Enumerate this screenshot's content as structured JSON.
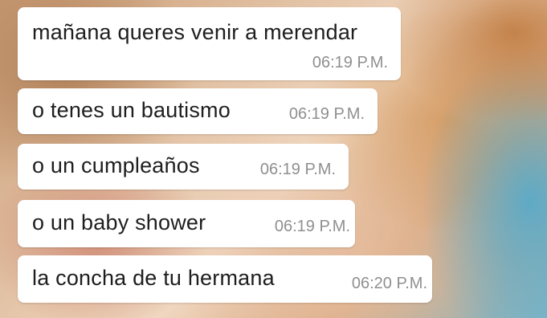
{
  "messages": [
    {
      "text": "mañana queres venir a merendar",
      "time": "06:19 P.M."
    },
    {
      "text": "o tenes un bautismo",
      "time": "06:19 P.M."
    },
    {
      "text": "o un cumpleaños",
      "time": "06:19 P.M."
    },
    {
      "text": "o un baby shower",
      "time": "06:19 P.M."
    },
    {
      "text": "la concha de tu hermana",
      "time": "06:20 P.M."
    }
  ],
  "colors": {
    "bubble": "#ffffff",
    "message_text": "#1e1e1e",
    "timestamp_text": "#8f8f8f"
  }
}
